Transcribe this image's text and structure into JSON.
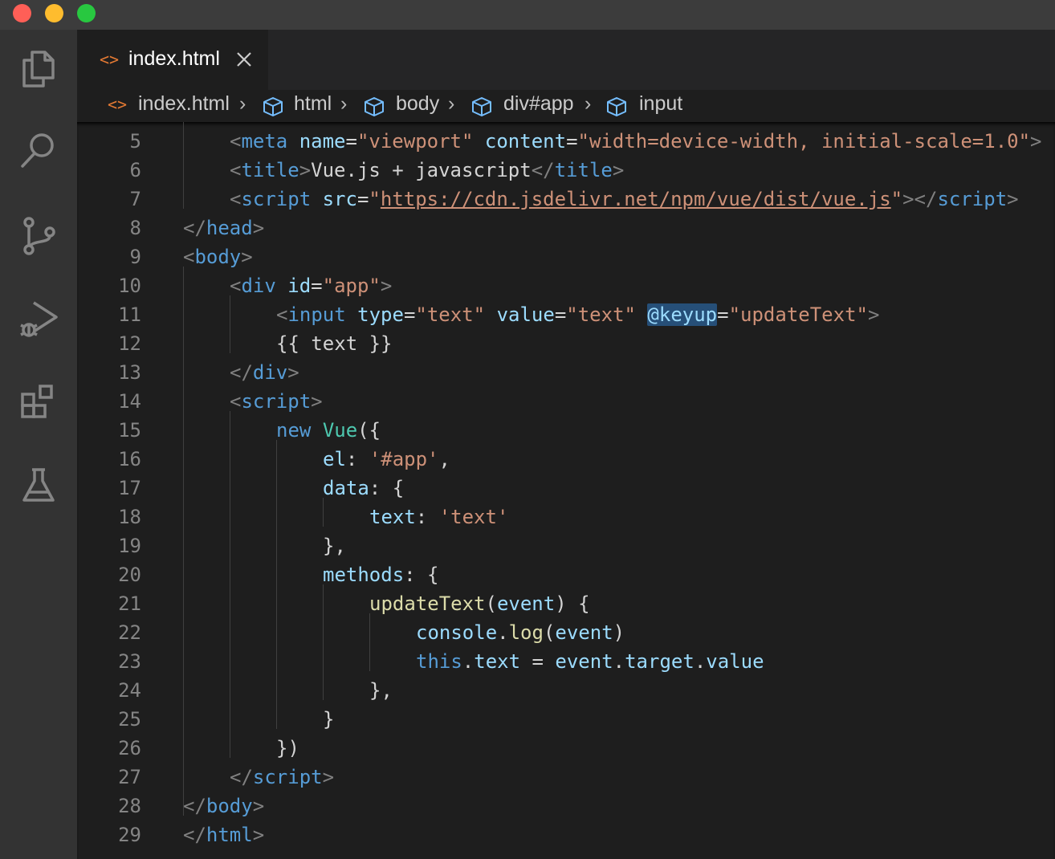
{
  "tab": {
    "label": "index.html",
    "icon": "html-file-icon"
  },
  "breadcrumbs": [
    "index.html",
    "html",
    "body",
    "div#app",
    "input"
  ],
  "activity_icons": [
    "explorer-icon",
    "search-icon",
    "source-control-icon",
    "run-debug-icon",
    "extensions-icon",
    "testing-icon"
  ],
  "colors": {
    "editor_bg": "#1e1e1e",
    "tag": "#569cd6",
    "attribute": "#9cdcfe",
    "string": "#ce9178",
    "function": "#dcdcaa",
    "class": "#4ec9b0",
    "highlight": "#264f78"
  },
  "lines": [
    {
      "n": "5",
      "tokens": [
        [
          "b",
          "<"
        ],
        [
          "t",
          "meta"
        ],
        [
          "p",
          " "
        ],
        [
          "a",
          "name"
        ],
        [
          "p",
          "="
        ],
        [
          "s",
          "\"viewport\""
        ],
        [
          "p",
          " "
        ],
        [
          "a",
          "content"
        ],
        [
          "p",
          "="
        ],
        [
          "s",
          "\"width=device-width, initial-scale=1.0\""
        ],
        [
          "b",
          ">"
        ]
      ]
    },
    {
      "n": "6",
      "tokens": [
        [
          "b",
          "<"
        ],
        [
          "t",
          "title"
        ],
        [
          "b",
          ">"
        ],
        [
          "p",
          "Vue.js + javascript"
        ],
        [
          "b",
          "</"
        ],
        [
          "t",
          "title"
        ],
        [
          "b",
          ">"
        ]
      ]
    },
    {
      "n": "7",
      "tokens": [
        [
          "b",
          "<"
        ],
        [
          "t",
          "script"
        ],
        [
          "p",
          " "
        ],
        [
          "a",
          "src"
        ],
        [
          "p",
          "="
        ],
        [
          "s",
          "\""
        ],
        [
          "u",
          "https://cdn.jsdelivr.net/npm/vue/dist/vue.js"
        ],
        [
          "s",
          "\""
        ],
        [
          "b",
          "></"
        ],
        [
          "t",
          "script"
        ],
        [
          "b",
          ">"
        ]
      ]
    },
    {
      "n": "8",
      "tokens": [
        [
          "b",
          "</"
        ],
        [
          "t",
          "head"
        ],
        [
          "b",
          ">"
        ]
      ]
    },
    {
      "n": "9",
      "tokens": [
        [
          "b",
          "<"
        ],
        [
          "t",
          "body"
        ],
        [
          "b",
          ">"
        ]
      ]
    },
    {
      "n": "10",
      "tokens": [
        [
          "b",
          "<"
        ],
        [
          "t",
          "div"
        ],
        [
          "p",
          " "
        ],
        [
          "a",
          "id"
        ],
        [
          "p",
          "="
        ],
        [
          "s",
          "\"app\""
        ],
        [
          "b",
          ">"
        ]
      ]
    },
    {
      "n": "11",
      "tokens": [
        [
          "b",
          "<"
        ],
        [
          "t",
          "input"
        ],
        [
          "p",
          " "
        ],
        [
          "a",
          "type"
        ],
        [
          "p",
          "="
        ],
        [
          "s",
          "\"text\""
        ],
        [
          "p",
          " "
        ],
        [
          "a",
          "value"
        ],
        [
          "p",
          "="
        ],
        [
          "s",
          "\"text\""
        ],
        [
          "p",
          " "
        ],
        [
          "ahl",
          "@keyup"
        ],
        [
          "p",
          "="
        ],
        [
          "s",
          "\"updateText\""
        ],
        [
          "b",
          ">"
        ]
      ]
    },
    {
      "n": "12",
      "tokens": [
        [
          "p",
          "{{ text }}"
        ]
      ]
    },
    {
      "n": "13",
      "tokens": [
        [
          "b",
          "</"
        ],
        [
          "t",
          "div"
        ],
        [
          "b",
          ">"
        ]
      ]
    },
    {
      "n": "14",
      "tokens": [
        [
          "b",
          "<"
        ],
        [
          "t",
          "script"
        ],
        [
          "b",
          ">"
        ]
      ]
    },
    {
      "n": "15",
      "tokens": [
        [
          "k",
          "new"
        ],
        [
          "p",
          " "
        ],
        [
          "c",
          "Vue"
        ],
        [
          "p",
          "({"
        ]
      ]
    },
    {
      "n": "16",
      "tokens": [
        [
          "a",
          "el"
        ],
        [
          "p",
          ": "
        ],
        [
          "s",
          "'#app'"
        ],
        [
          "p",
          ","
        ]
      ]
    },
    {
      "n": "17",
      "tokens": [
        [
          "a",
          "data"
        ],
        [
          "p",
          ": {"
        ]
      ]
    },
    {
      "n": "18",
      "tokens": [
        [
          "a",
          "text"
        ],
        [
          "p",
          ": "
        ],
        [
          "s",
          "'text'"
        ]
      ]
    },
    {
      "n": "19",
      "tokens": [
        [
          "p",
          "},"
        ]
      ]
    },
    {
      "n": "20",
      "tokens": [
        [
          "a",
          "methods"
        ],
        [
          "p",
          ": {"
        ]
      ]
    },
    {
      "n": "21",
      "tokens": [
        [
          "f",
          "updateText"
        ],
        [
          "p",
          "("
        ],
        [
          "a",
          "event"
        ],
        [
          "p",
          ") {"
        ]
      ]
    },
    {
      "n": "22",
      "tokens": [
        [
          "a",
          "console"
        ],
        [
          "p",
          "."
        ],
        [
          "f",
          "log"
        ],
        [
          "p",
          "("
        ],
        [
          "a",
          "event"
        ],
        [
          "p",
          ")"
        ]
      ]
    },
    {
      "n": "23",
      "tokens": [
        [
          "k",
          "this"
        ],
        [
          "p",
          "."
        ],
        [
          "a",
          "text"
        ],
        [
          "p",
          " = "
        ],
        [
          "a",
          "event"
        ],
        [
          "p",
          "."
        ],
        [
          "a",
          "target"
        ],
        [
          "p",
          "."
        ],
        [
          "a",
          "value"
        ]
      ]
    },
    {
      "n": "24",
      "tokens": [
        [
          "p",
          "},"
        ]
      ]
    },
    {
      "n": "25",
      "tokens": [
        [
          "p",
          "}"
        ]
      ]
    },
    {
      "n": "26",
      "tokens": [
        [
          "p",
          "})"
        ]
      ]
    },
    {
      "n": "27",
      "tokens": [
        [
          "b",
          "</"
        ],
        [
          "t",
          "script"
        ],
        [
          "b",
          ">"
        ]
      ]
    },
    {
      "n": "28",
      "tokens": [
        [
          "b",
          "</"
        ],
        [
          "t",
          "body"
        ],
        [
          "b",
          ">"
        ]
      ]
    },
    {
      "n": "29",
      "tokens": [
        [
          "b",
          "</"
        ],
        [
          "t",
          "html"
        ],
        [
          "b",
          ">"
        ]
      ]
    }
  ]
}
